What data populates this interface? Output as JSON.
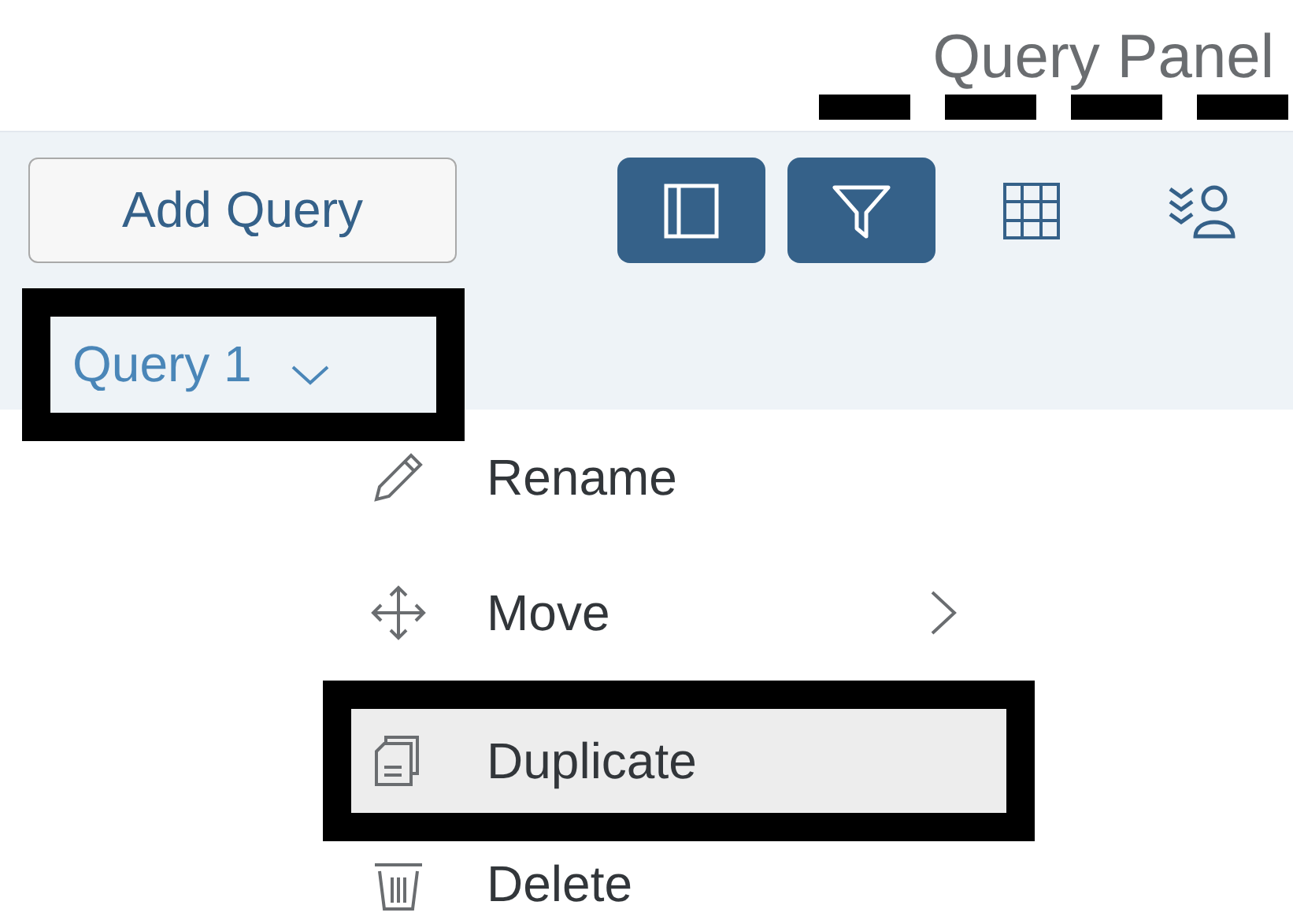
{
  "panel_title": "Query Panel",
  "toolbar": {
    "add_button": "Add Query",
    "buttons": [
      {
        "kind": "panel",
        "selected": true,
        "marked": true
      },
      {
        "kind": "filter",
        "selected": true,
        "marked": true
      },
      {
        "kind": "grid",
        "selected": false,
        "marked": true
      },
      {
        "kind": "people",
        "selected": false,
        "marked": true
      }
    ]
  },
  "query_tab": {
    "label": "Query 1",
    "highlighted": true
  },
  "menu": [
    {
      "kind": "rename",
      "label": "Rename",
      "submenu": false,
      "selected": false,
      "highlighted": false
    },
    {
      "kind": "move",
      "label": "Move",
      "submenu": true,
      "selected": false,
      "highlighted": false
    },
    {
      "kind": "duplicate",
      "label": "Duplicate",
      "submenu": false,
      "selected": true,
      "highlighted": true
    },
    {
      "kind": "delete",
      "label": "Delete",
      "submenu": false,
      "selected": false,
      "highlighted": false
    }
  ]
}
